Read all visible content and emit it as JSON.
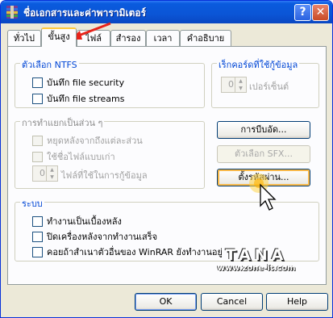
{
  "window": {
    "title": "ชื่อเอกสารและค่าพารามิเตอร์",
    "help_glyph": "?",
    "close_glyph": "✕"
  },
  "tabs": [
    {
      "label": "ทั่วไป"
    },
    {
      "label": "ขั้นสูง",
      "active": true
    },
    {
      "label": "ไฟล์"
    },
    {
      "label": "สำรอง"
    },
    {
      "label": "เวลา"
    },
    {
      "label": "คำอธิบาย"
    }
  ],
  "ntfs": {
    "label": "ตัวเลือก NTFS",
    "options": [
      {
        "label": "บันทึก file security",
        "checked": false
      },
      {
        "label": "บันทึก file streams",
        "checked": false
      }
    ]
  },
  "recovery": {
    "label": "เร็กคอร์ดที่ใช้กู้ข้อมูล",
    "value": "0",
    "unit": "เปอร์เซ็นต์"
  },
  "volumes": {
    "label": "การทำแยกเป็นส่วน ๆ",
    "options": [
      {
        "label": "หยุดหลังจากถึงแต่ละส่วน",
        "checked": false
      },
      {
        "label": "ใช้ชื่อไฟล์แบบเก่า",
        "checked": false
      }
    ],
    "spinner_value": "0",
    "spinner_label": "ไฟล์ที่ใช้ในการกู้ข้อมูล"
  },
  "buttons": {
    "compression": "การบีบอัด...",
    "sfx": "ตัวเลือก SFX...",
    "password": "ตั้งรหัสผ่าน..."
  },
  "system": {
    "label": "ระบบ",
    "options": [
      {
        "label": "ทำงานเป็นเบื้องหลัง",
        "checked": false
      },
      {
        "label": "ปิดเครื่องหลังจากทำงานเสร็จ",
        "checked": false
      },
      {
        "label": "คอยถ้าสำเนาตัวอื่นของ WinRAR ยังทำงานอยู่",
        "checked": false
      }
    ]
  },
  "footer": {
    "ok": "OK",
    "cancel": "Cancel",
    "help": "Help"
  },
  "watermark": {
    "title": "TANA",
    "url": "www.zone-it.com"
  },
  "colors": {
    "titlebar": "#0A5BDE",
    "face": "#ECE9D8",
    "group_label": "#0046D5",
    "annotation_arrow": "#E8231A"
  }
}
